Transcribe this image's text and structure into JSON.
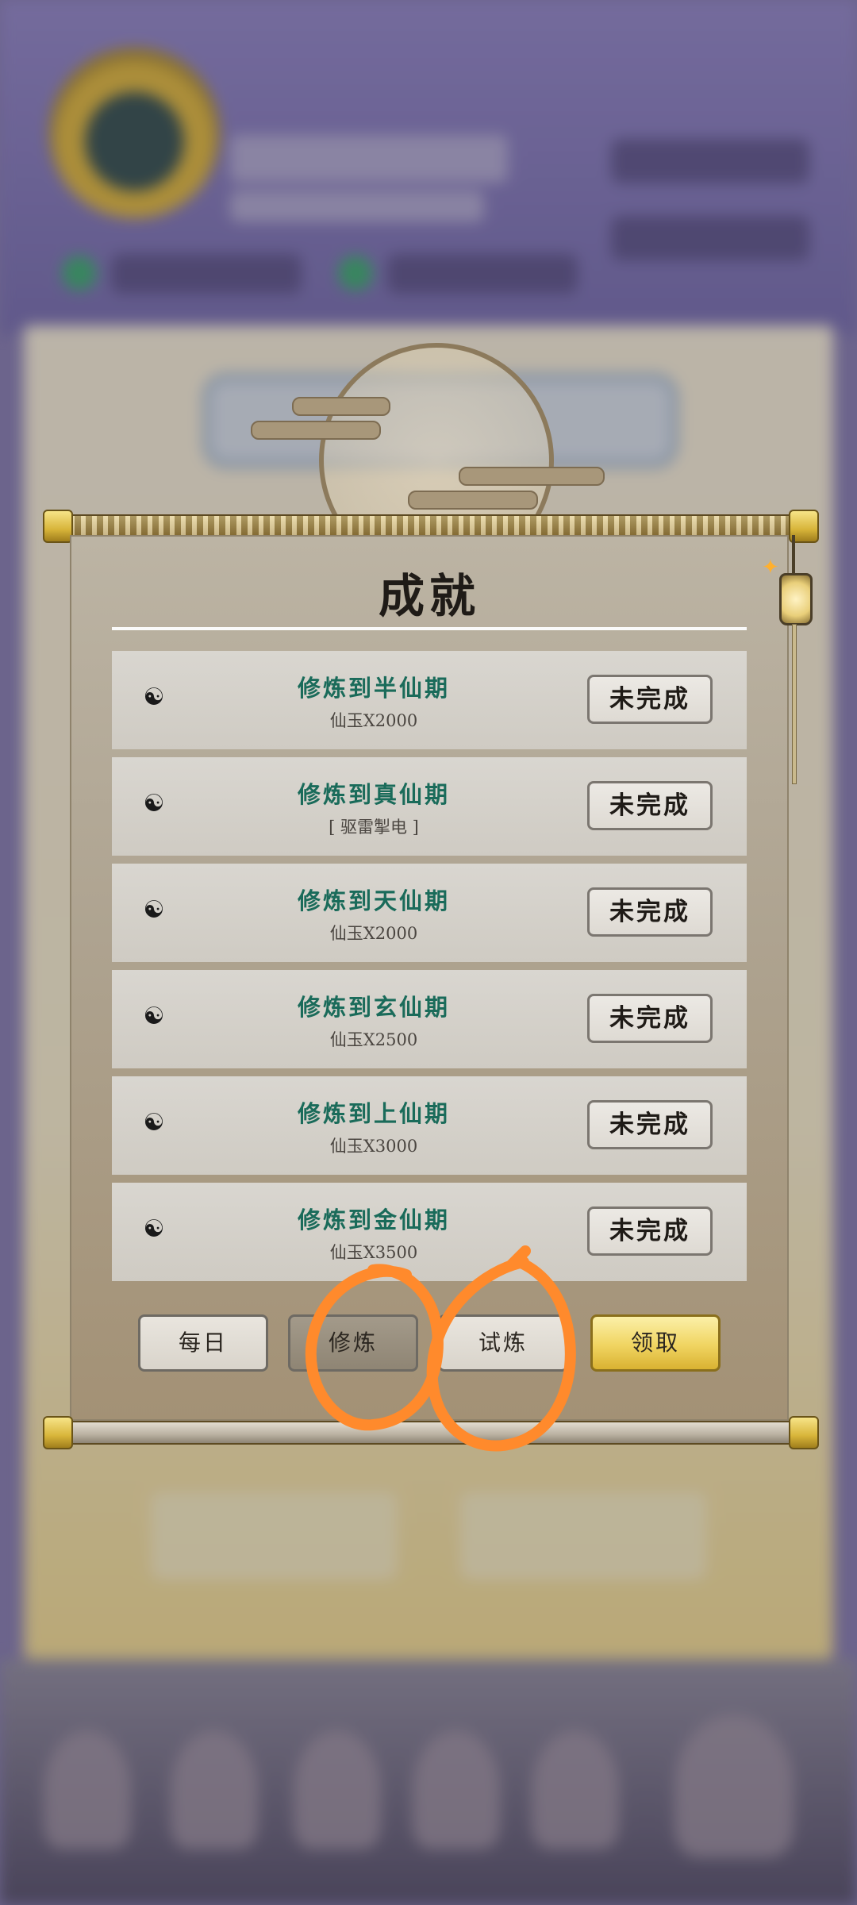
{
  "panel": {
    "title": "成就",
    "achievements": [
      {
        "icon": "yin-yang-icon",
        "name": "修炼到半仙期",
        "reward": "仙玉X2000",
        "status": "未完成"
      },
      {
        "icon": "yin-yang-icon",
        "name": "修炼到真仙期",
        "reward": "[ 驱雷掣电 ]",
        "status": "未完成"
      },
      {
        "icon": "yin-yang-icon",
        "name": "修炼到天仙期",
        "reward": "仙玉X2000",
        "status": "未完成"
      },
      {
        "icon": "yin-yang-icon",
        "name": "修炼到玄仙期",
        "reward": "仙玉X2500",
        "status": "未完成"
      },
      {
        "icon": "yin-yang-icon",
        "name": "修炼到上仙期",
        "reward": "仙玉X3000",
        "status": "未完成"
      },
      {
        "icon": "yin-yang-icon",
        "name": "修炼到金仙期",
        "reward": "仙玉X3500",
        "status": "未完成"
      }
    ],
    "tabs": {
      "daily": "每日",
      "cultivate": "修炼",
      "trial": "试炼",
      "claim": "领取"
    },
    "active_tab": "修炼"
  },
  "colors": {
    "achievement_name": "#1a6b5a",
    "annotation": "#ff8a2c",
    "claim_button": "#f0d461"
  }
}
